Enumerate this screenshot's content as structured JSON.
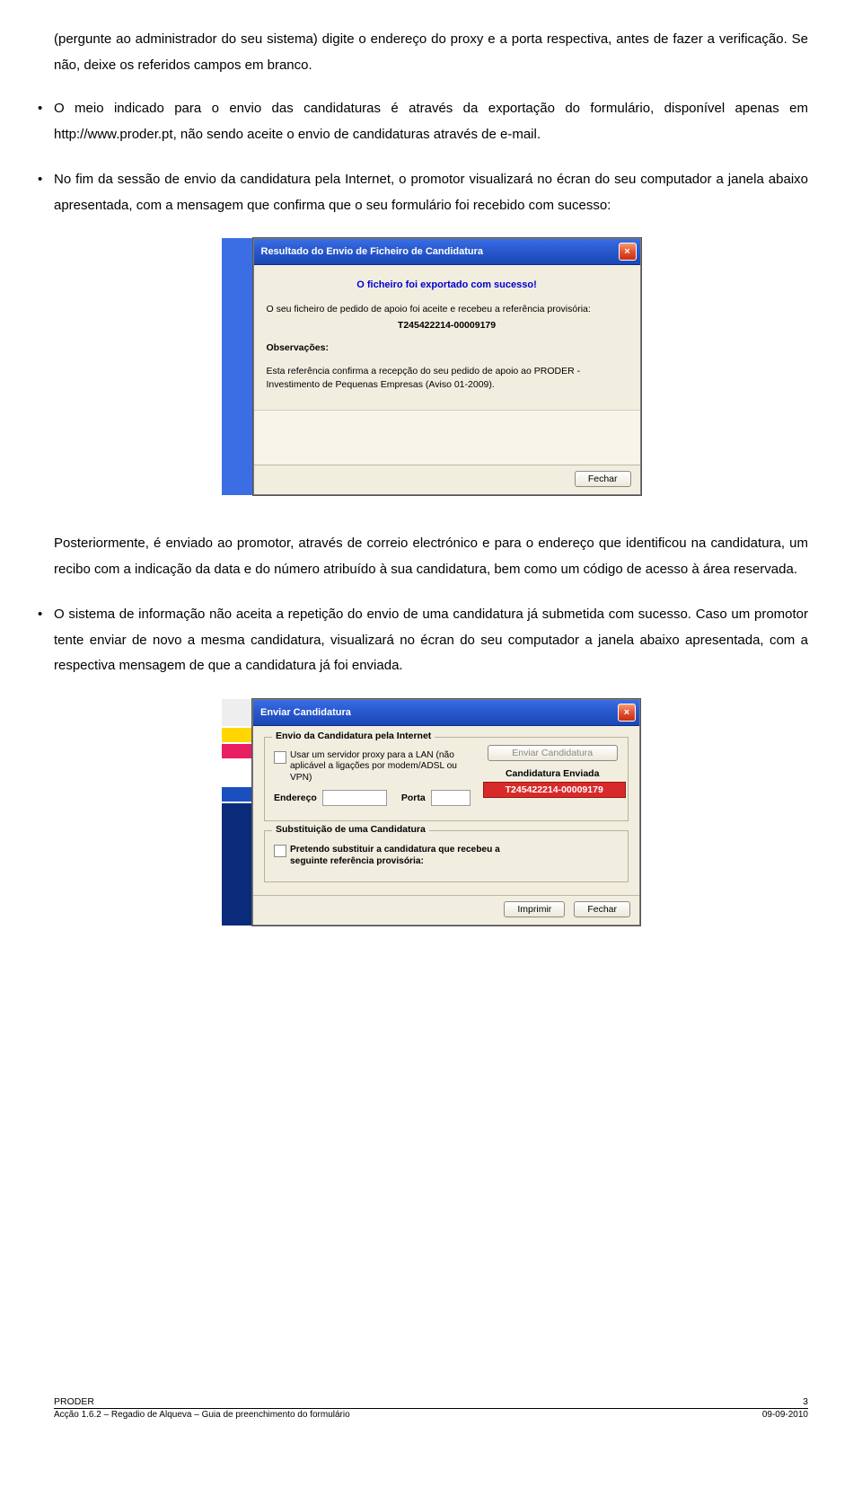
{
  "body": {
    "p0": "(pergunte ao administrador do seu sistema) digite o endereço do proxy e a porta respectiva, antes de fazer a verificação. Se não, deixe os referidos campos em branco.",
    "b1": "O meio indicado para o envio das candidaturas é através da exportação do formulário, disponível apenas em http://www.proder.pt, não sendo aceite o envio de candidaturas através de e-mail.",
    "b2": "No fim da sessão de envio da candidatura pela Internet, o promotor visualizará no écran do seu computador a janela abaixo apresentada, com a mensagem que confirma que o seu formulário foi recebido com sucesso:",
    "p3": "Posteriormente, é enviado ao promotor, através de correio electrónico e para o endereço que identificou na candidatura, um recibo com a indicação da data e do número atribuído à sua candidatura, bem como um código de acesso à área reservada.",
    "b4": "O sistema de informação não aceita a repetição do envio de uma candidatura já submetida com sucesso. Caso um promotor tente enviar de novo a mesma candidatura, visualizará no écran do seu computador a janela abaixo apresentada, com a respectiva mensagem de que a candidatura já foi enviada."
  },
  "dialog1": {
    "title": "Resultado do Envio de Ficheiro de Candidatura",
    "success": "O ficheiro foi exportado com sucesso!",
    "line1": "O seu ficheiro de pedido de apoio foi aceite e recebeu a referência provisória:",
    "ref": "T245422214-00009179",
    "obs_label": "Observações:",
    "obs_text": "Esta referência confirma a recepção do seu pedido de apoio ao PRODER - Investimento de Pequenas Empresas (Aviso 01-2009).",
    "close_label": "Fechar"
  },
  "dialog2": {
    "title": "Enviar Candidatura",
    "group1_legend": "Envio da Candidatura pela Internet",
    "proxy_text": "Usar um servidor proxy para a LAN (não aplicável a ligações por modem/ADSL ou VPN)",
    "endereco_label": "Endereço",
    "porta_label": "Porta",
    "send_btn": "Enviar Candidatura",
    "sent_label": "Candidatura Enviada",
    "sent_ref": "T245422214-00009179",
    "group2_legend": "Substituição de uma Candidatura",
    "subst_text": "Pretendo substituir a candidatura que recebeu a seguinte referência provisória:",
    "print_btn": "Imprimir",
    "close_btn": "Fechar"
  },
  "footer": {
    "left_top": "PRODER",
    "right_top": "3",
    "left_bottom": "Acção 1.6.2 – Regadio de Alqueva –  Guia  de preenchimento do formulário",
    "right_bottom": "09-09-2010"
  }
}
